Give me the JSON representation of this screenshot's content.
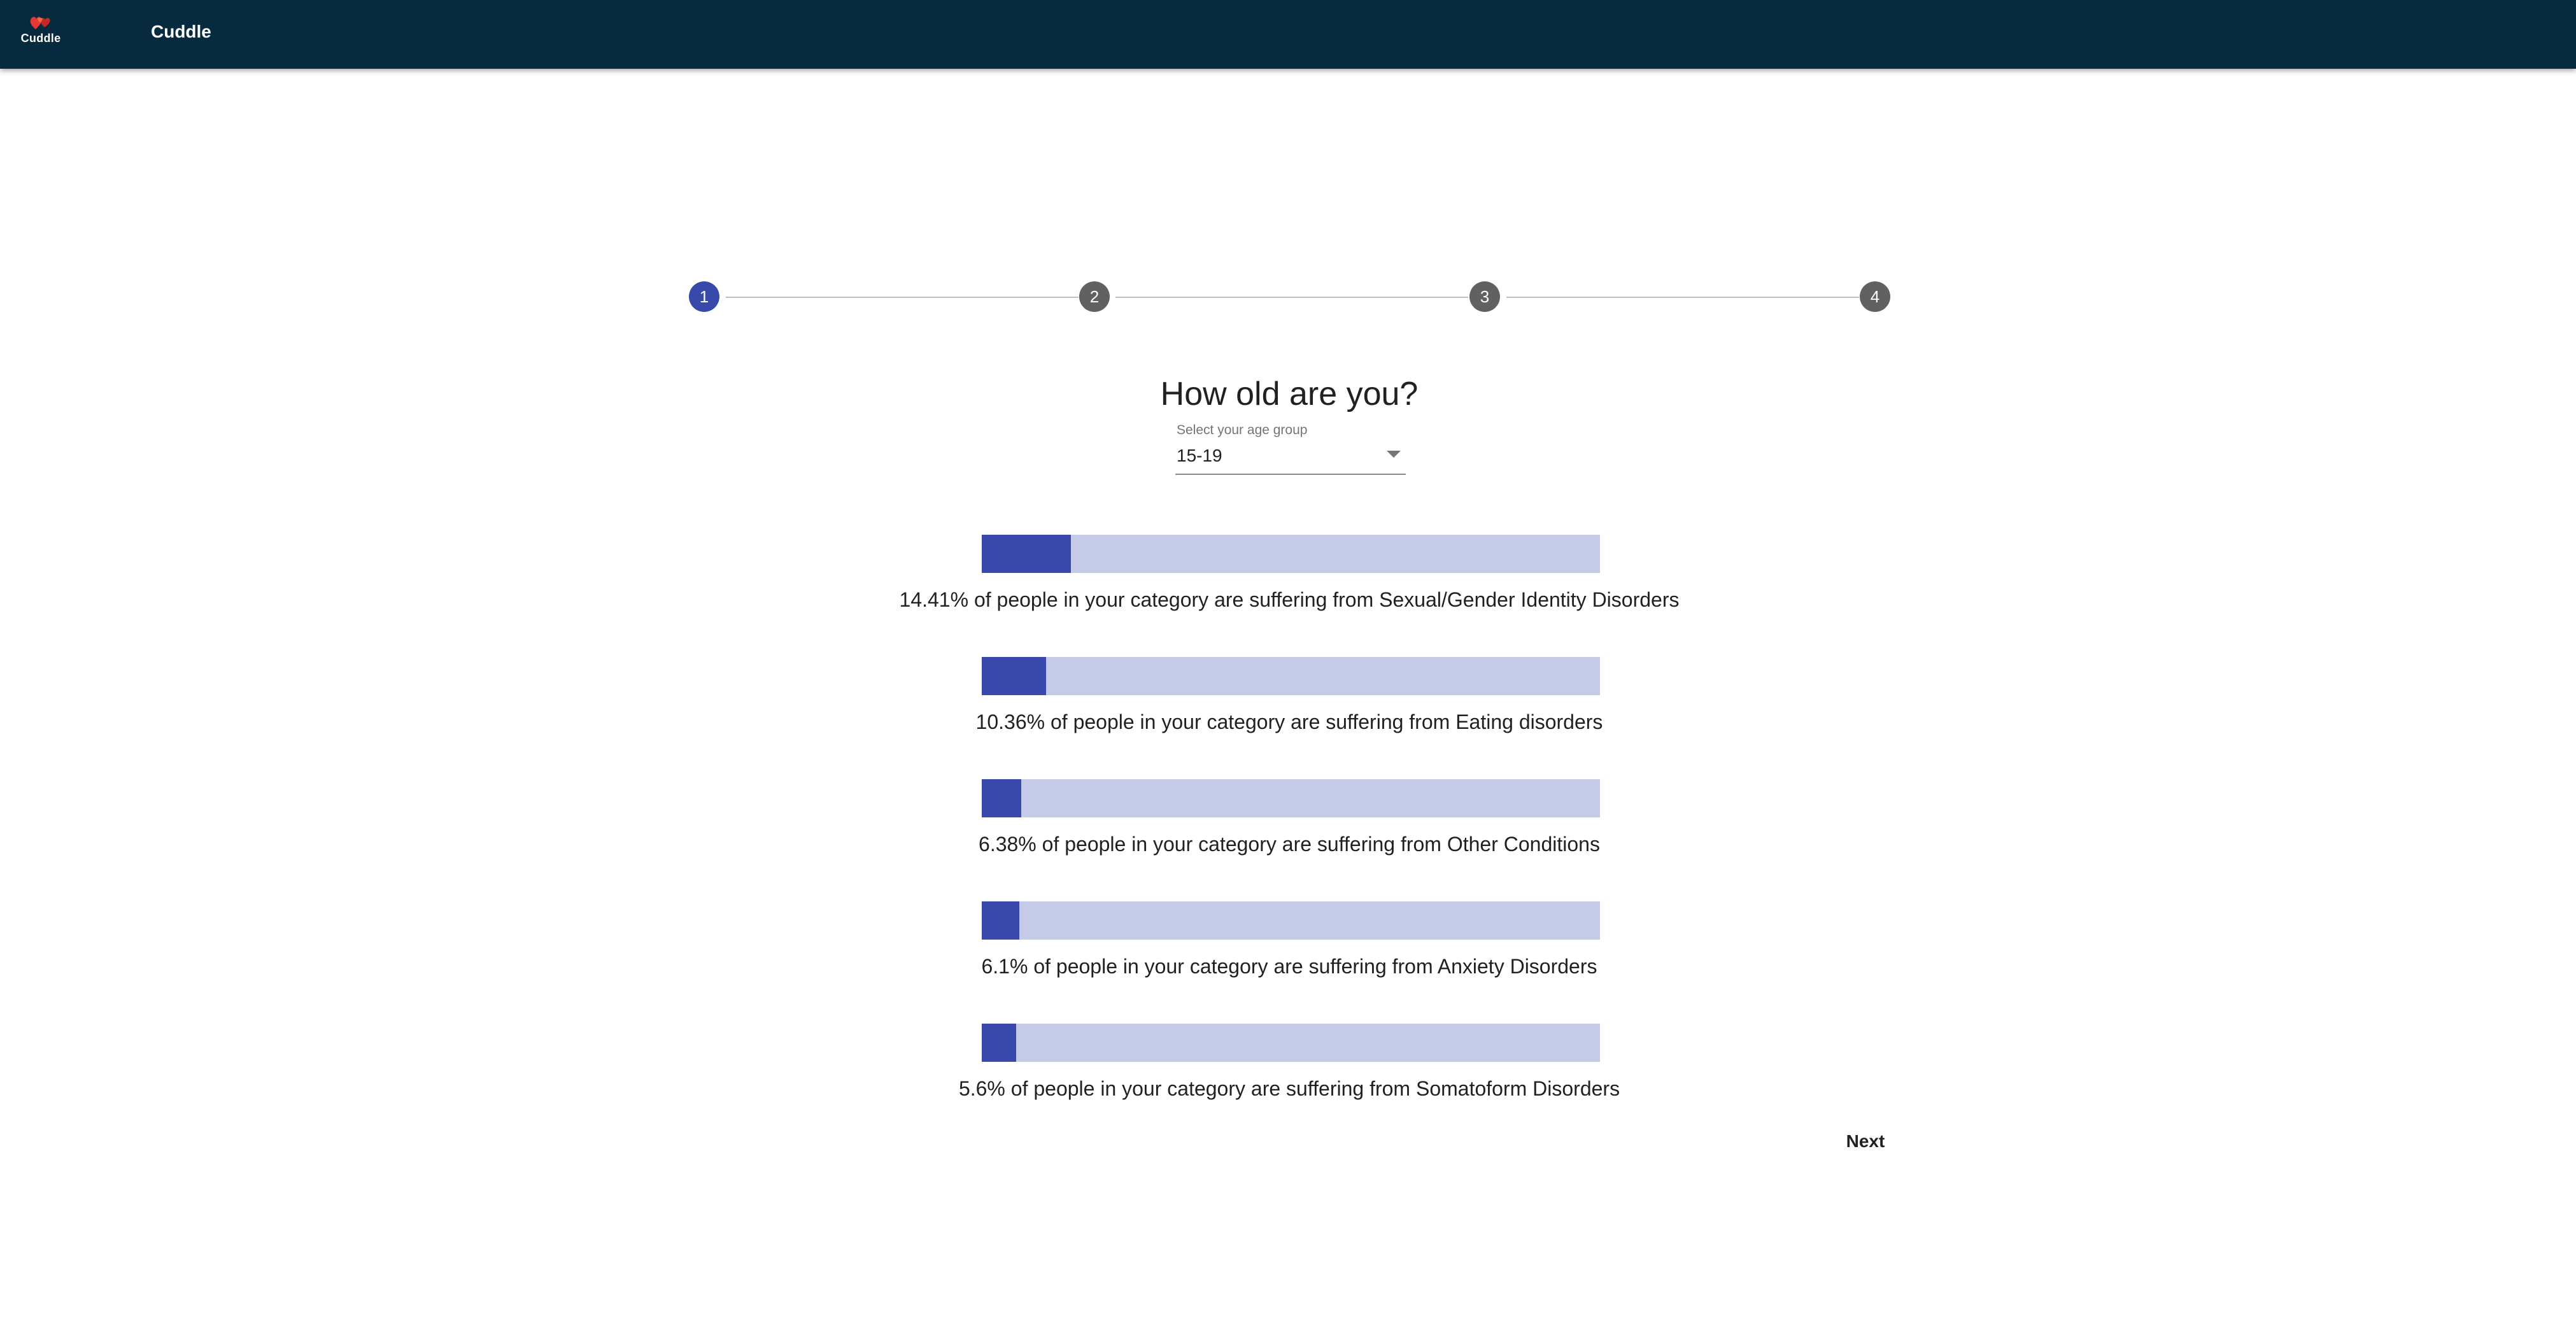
{
  "header": {
    "logo_label": "Cuddle",
    "title": "Cuddle",
    "logo_icon": "hearts-icon",
    "background_color": "#082a3e"
  },
  "stepper": {
    "steps": [
      "1",
      "2",
      "3",
      "4"
    ],
    "active_step": 1,
    "active_color": "#3949ab",
    "inactive_color": "#616161"
  },
  "question": {
    "title": "How old are you?",
    "select_label": "Select your age group",
    "select_value": "15-19"
  },
  "stats": [
    {
      "text": "14.41% of people in your category are suffering from Sexual/Gender Identity Disorders",
      "percent": 14.41
    },
    {
      "text": "10.36% of people in your category are suffering from Eating disorders",
      "percent": 10.36
    },
    {
      "text": "6.38% of people in your category are suffering from Other Conditions",
      "percent": 6.38
    },
    {
      "text": "6.1% of people in your category are suffering from Anxiety Disorders",
      "percent": 6.1
    },
    {
      "text": "5.6% of people in your category are suffering from Somatoform Disorders",
      "percent": 5.6
    }
  ],
  "bar_colors": {
    "fill": "#3949ab",
    "track": "#c5cae9"
  },
  "actions": {
    "next_label": "Next"
  }
}
